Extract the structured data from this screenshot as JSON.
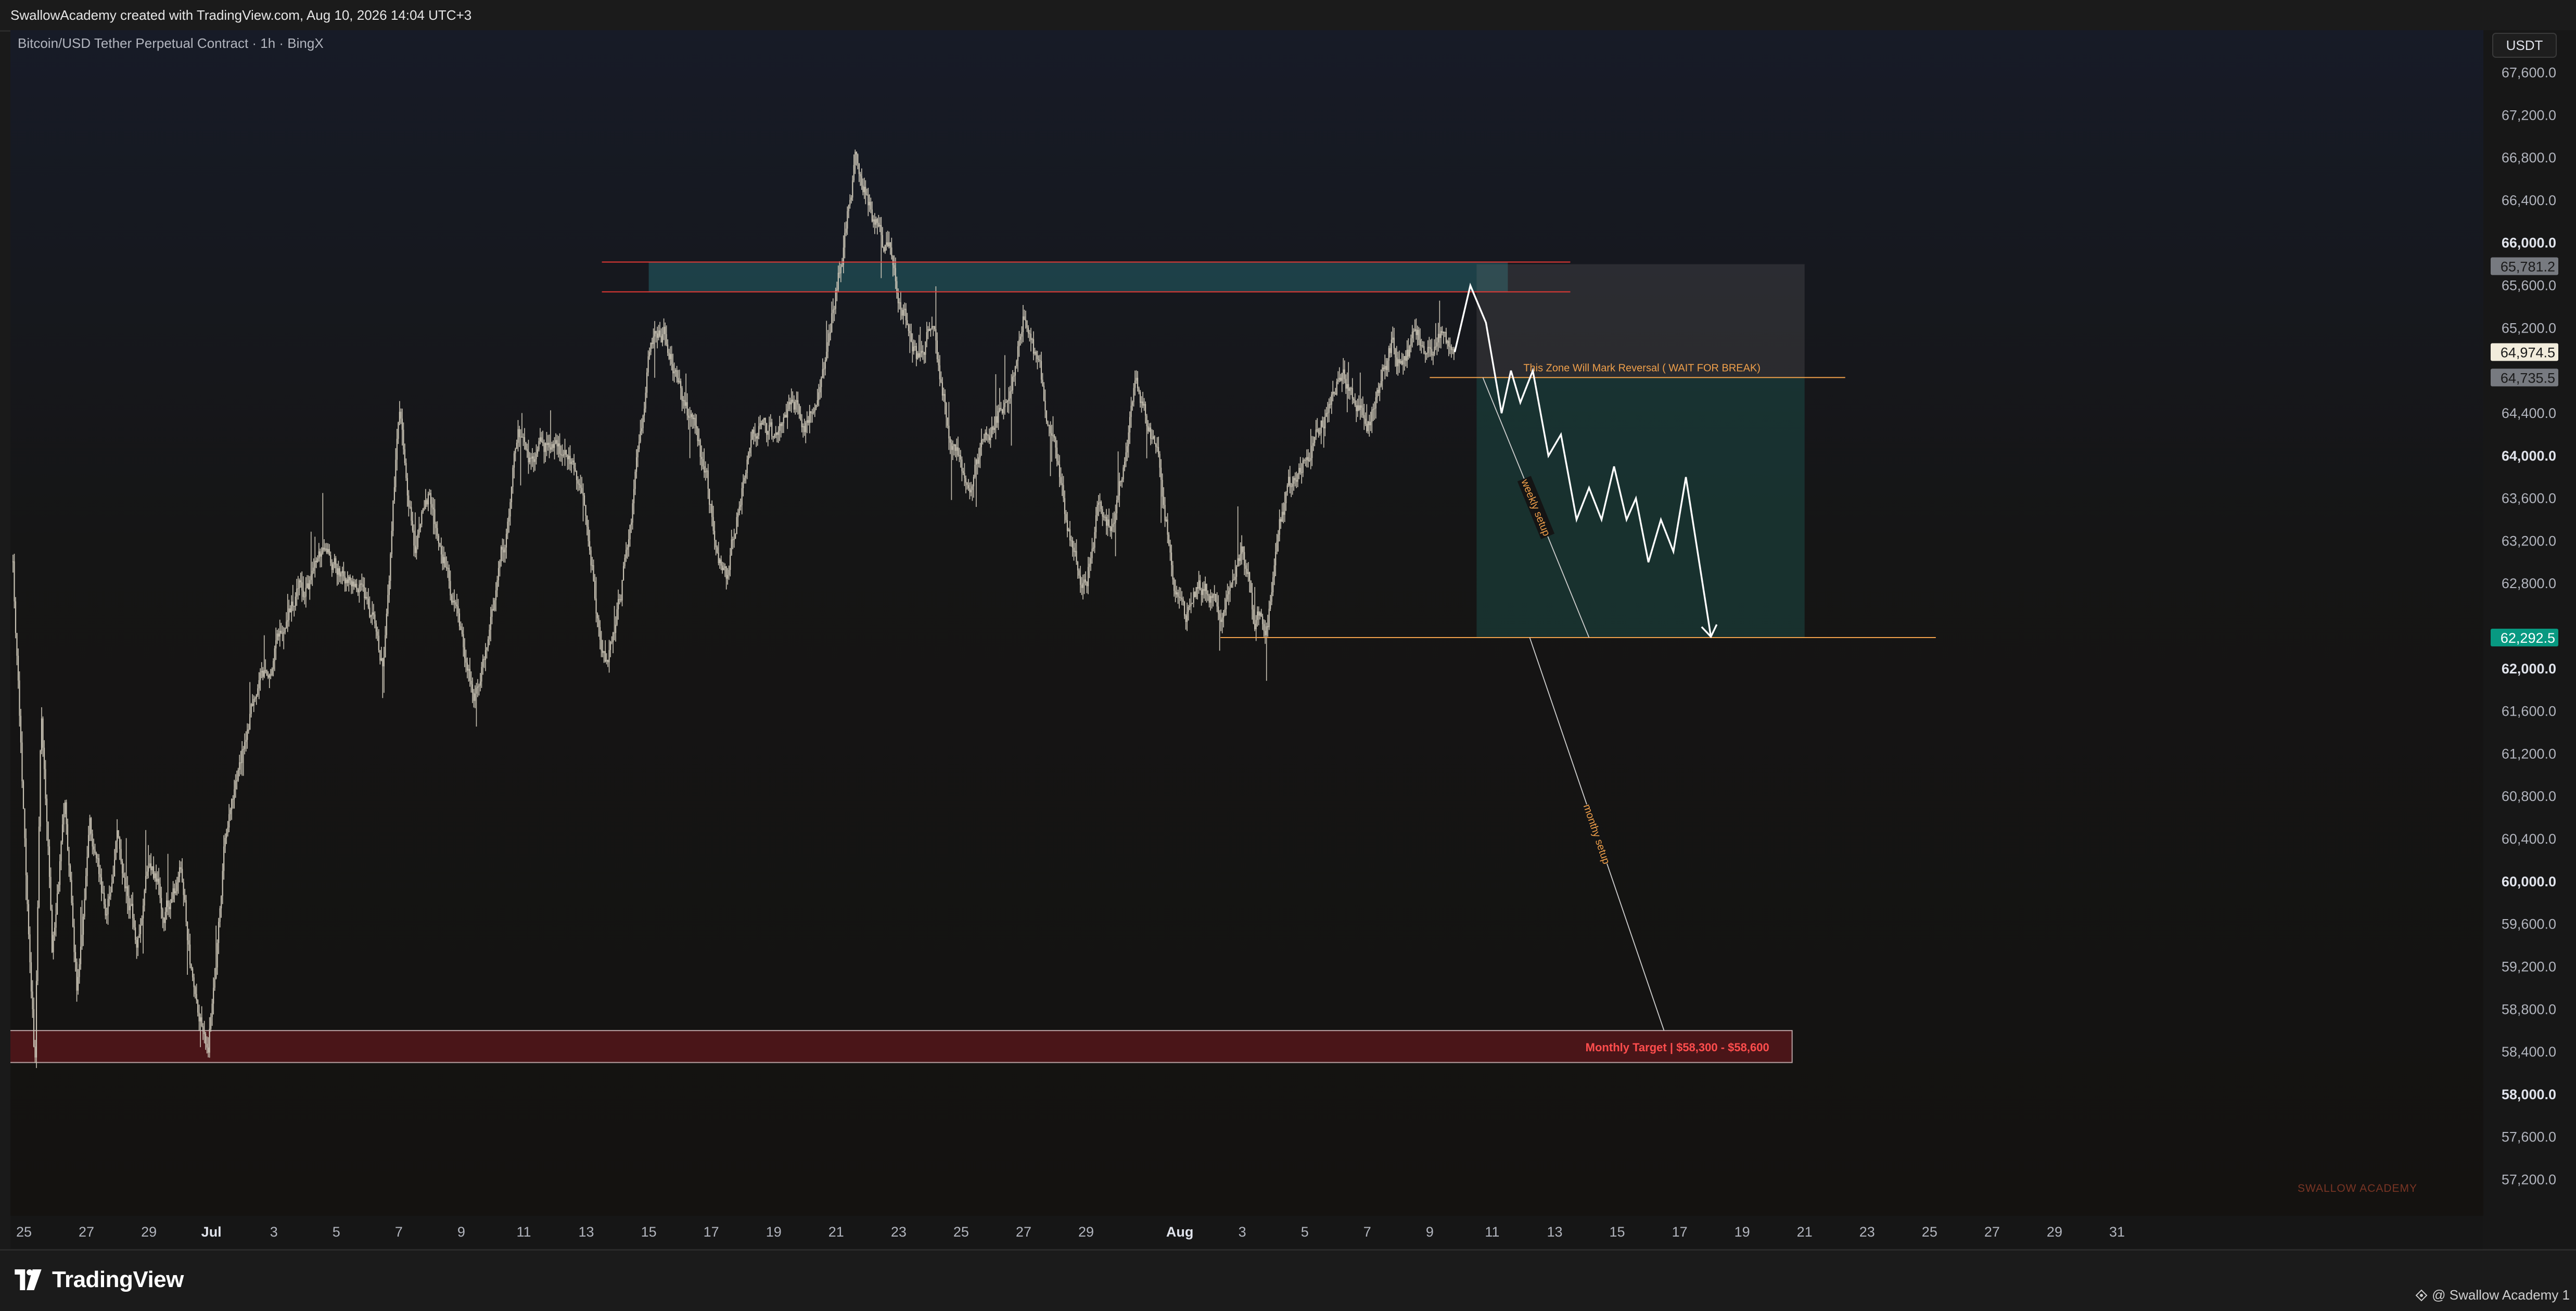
{
  "header": {
    "credit_text": "SwallowAcademy created with TradingView.com, Aug 10, 2026 14:04 UTC+3"
  },
  "chart_header": {
    "symbol_title": "Bitcoin/USD Tether Perpetual Contract · 1h · BingX",
    "currency_button": "USDT"
  },
  "footer": {
    "brand_name": "TradingView",
    "publisher": "@ Swallow Academy 1"
  },
  "colors": {
    "candles": "#c9c3b4",
    "zone_red": "#e53935",
    "zone_teal": "#26707a",
    "orange": "#f0a04b",
    "target_red": "#e53935",
    "badge_green": "#089981",
    "projection": "#ffffff"
  },
  "chart_data": {
    "type": "candlestick",
    "title": "Bitcoin/USD Tether Perpetual Contract · 1h · BingX",
    "y_axis": {
      "currency": "USDT",
      "range": [
        57000,
        67800
      ],
      "ticks": [
        {
          "label": "67,600.0",
          "value": 67600,
          "bold": false
        },
        {
          "label": "67,200.0",
          "value": 67200,
          "bold": false
        },
        {
          "label": "66,800.0",
          "value": 66800,
          "bold": false
        },
        {
          "label": "66,400.0",
          "value": 66400,
          "bold": false
        },
        {
          "label": "66,000.0",
          "value": 66000,
          "bold": true
        },
        {
          "label": "65,600.0",
          "value": 65600,
          "bold": false
        },
        {
          "label": "65,200.0",
          "value": 65200,
          "bold": false
        },
        {
          "label": "64,400.0",
          "value": 64400,
          "bold": false
        },
        {
          "label": "64,000.0",
          "value": 64000,
          "bold": true
        },
        {
          "label": "63,600.0",
          "value": 63600,
          "bold": false
        },
        {
          "label": "63,200.0",
          "value": 63200,
          "bold": false
        },
        {
          "label": "62,800.0",
          "value": 62800,
          "bold": false
        },
        {
          "label": "62,000.0",
          "value": 62000,
          "bold": true
        },
        {
          "label": "61,600.0",
          "value": 61600,
          "bold": false
        },
        {
          "label": "61,200.0",
          "value": 61200,
          "bold": false
        },
        {
          "label": "60,800.0",
          "value": 60800,
          "bold": false
        },
        {
          "label": "60,400.0",
          "value": 60400,
          "bold": false
        },
        {
          "label": "60,000.0",
          "value": 60000,
          "bold": true
        },
        {
          "label": "59,600.0",
          "value": 59600,
          "bold": false
        },
        {
          "label": "59,200.0",
          "value": 59200,
          "bold": false
        },
        {
          "label": "58,800.0",
          "value": 58800,
          "bold": false
        },
        {
          "label": "58,400.0",
          "value": 58400,
          "bold": false
        },
        {
          "label": "58,000.0",
          "value": 58000,
          "bold": true
        },
        {
          "label": "57,600.0",
          "value": 57600,
          "bold": false
        },
        {
          "label": "57,200.0",
          "value": 57200,
          "bold": false
        }
      ],
      "badges": [
        {
          "label": "65,781.2",
          "value": 65781.2,
          "style": "gray"
        },
        {
          "label": "64,974.5",
          "value": 64974.5,
          "style": "light"
        },
        {
          "label": "64,735.5",
          "value": 64735.5,
          "style": "gray"
        },
        {
          "label": "62,292.5",
          "value": 62292.5,
          "style": "green"
        }
      ]
    },
    "x_axis": {
      "range": [
        0,
        67
      ],
      "ticks": [
        {
          "label": "25",
          "day": 0,
          "bold": false
        },
        {
          "label": "27",
          "day": 2,
          "bold": false
        },
        {
          "label": "29",
          "day": 4,
          "bold": false
        },
        {
          "label": "Jul",
          "day": 6,
          "bold": true
        },
        {
          "label": "3",
          "day": 8,
          "bold": false
        },
        {
          "label": "5",
          "day": 10,
          "bold": false
        },
        {
          "label": "7",
          "day": 12,
          "bold": false
        },
        {
          "label": "9",
          "day": 14,
          "bold": false
        },
        {
          "label": "11",
          "day": 16,
          "bold": false
        },
        {
          "label": "13",
          "day": 18,
          "bold": false
        },
        {
          "label": "15",
          "day": 20,
          "bold": false
        },
        {
          "label": "17",
          "day": 22,
          "bold": false
        },
        {
          "label": "19",
          "day": 24,
          "bold": false
        },
        {
          "label": "21",
          "day": 26,
          "bold": false
        },
        {
          "label": "23",
          "day": 28,
          "bold": false
        },
        {
          "label": "25",
          "day": 30,
          "bold": false
        },
        {
          "label": "27",
          "day": 32,
          "bold": false
        },
        {
          "label": "29",
          "day": 34,
          "bold": false
        },
        {
          "label": "Aug",
          "day": 37,
          "bold": true
        },
        {
          "label": "3",
          "day": 39,
          "bold": false
        },
        {
          "label": "5",
          "day": 41,
          "bold": false
        },
        {
          "label": "7",
          "day": 43,
          "bold": false
        },
        {
          "label": "9",
          "day": 45,
          "bold": false
        },
        {
          "label": "11",
          "day": 47,
          "bold": false
        },
        {
          "label": "13",
          "day": 49,
          "bold": false
        },
        {
          "label": "15",
          "day": 51,
          "bold": false
        },
        {
          "label": "17",
          "day": 53,
          "bold": false
        },
        {
          "label": "19",
          "day": 55,
          "bold": false
        },
        {
          "label": "21",
          "day": 57,
          "bold": false
        },
        {
          "label": "23",
          "day": 59,
          "bold": false
        },
        {
          "label": "25",
          "day": 61,
          "bold": false
        },
        {
          "label": "27",
          "day": 63,
          "bold": false
        },
        {
          "label": "29",
          "day": 65,
          "bold": false
        },
        {
          "label": "31",
          "day": 67,
          "bold": false
        }
      ]
    },
    "price_path": [
      [
        -0.35,
        63000
      ],
      [
        0.0,
        60500
      ],
      [
        0.35,
        58300
      ],
      [
        0.55,
        61800
      ],
      [
        0.9,
        59300
      ],
      [
        1.3,
        60800
      ],
      [
        1.7,
        59000
      ],
      [
        2.1,
        60700
      ],
      [
        2.6,
        59700
      ],
      [
        3.0,
        60500
      ],
      [
        3.6,
        59500
      ],
      [
        4.0,
        60300
      ],
      [
        4.5,
        59700
      ],
      [
        5.0,
        60100
      ],
      [
        5.5,
        58700
      ],
      [
        5.9,
        58500
      ],
      [
        6.4,
        60300
      ],
      [
        7.0,
        61200
      ],
      [
        7.5,
        61900
      ],
      [
        8.0,
        62200
      ],
      [
        8.6,
        62600
      ],
      [
        9.1,
        62800
      ],
      [
        9.6,
        63200
      ],
      [
        10.1,
        63000
      ],
      [
        10.6,
        62800
      ],
      [
        11.1,
        62600
      ],
      [
        11.5,
        62000
      ],
      [
        12.0,
        64400
      ],
      [
        12.5,
        63200
      ],
      [
        13.0,
        63600
      ],
      [
        13.5,
        63000
      ],
      [
        14.0,
        62200
      ],
      [
        14.5,
        61800
      ],
      [
        15.0,
        62600
      ],
      [
        15.4,
        63200
      ],
      [
        15.8,
        64200
      ],
      [
        16.3,
        63800
      ],
      [
        16.8,
        64100
      ],
      [
        17.3,
        64000
      ],
      [
        17.8,
        63800
      ],
      [
        18.3,
        62700
      ],
      [
        18.7,
        62100
      ],
      [
        19.1,
        62700
      ],
      [
        19.6,
        63800
      ],
      [
        20.0,
        64900
      ],
      [
        20.5,
        65100
      ],
      [
        21.0,
        64600
      ],
      [
        21.5,
        64200
      ],
      [
        22.0,
        63500
      ],
      [
        22.5,
        62800
      ],
      [
        23.0,
        63800
      ],
      [
        23.5,
        64300
      ],
      [
        24.0,
        64100
      ],
      [
        24.5,
        64600
      ],
      [
        25.0,
        64300
      ],
      [
        25.4,
        64600
      ],
      [
        25.8,
        65300
      ],
      [
        26.2,
        66000
      ],
      [
        26.6,
        66800
      ],
      [
        27.0,
        66400
      ],
      [
        27.4,
        66100
      ],
      [
        27.8,
        65800
      ],
      [
        28.1,
        65500
      ],
      [
        28.6,
        64900
      ],
      [
        29.0,
        65300
      ],
      [
        29.4,
        64600
      ],
      [
        29.8,
        64000
      ],
      [
        30.2,
        63700
      ],
      [
        30.7,
        64100
      ],
      [
        31.2,
        64400
      ],
      [
        31.6,
        64600
      ],
      [
        32.0,
        65300
      ],
      [
        32.4,
        64900
      ],
      [
        32.8,
        64300
      ],
      [
        33.2,
        63700
      ],
      [
        33.6,
        63100
      ],
      [
        34.0,
        62800
      ],
      [
        34.4,
        63600
      ],
      [
        34.8,
        63300
      ],
      [
        35.2,
        63900
      ],
      [
        35.6,
        64700
      ],
      [
        36.0,
        64400
      ],
      [
        36.4,
        63800
      ],
      [
        36.8,
        63000
      ],
      [
        37.2,
        62500
      ],
      [
        37.6,
        62800
      ],
      [
        38.0,
        62700
      ],
      [
        38.3,
        62400
      ],
      [
        38.6,
        62900
      ],
      [
        39.0,
        63200
      ],
      [
        39.4,
        62500
      ],
      [
        39.8,
        62400
      ],
      [
        40.2,
        63500
      ],
      [
        40.6,
        63700
      ],
      [
        41.0,
        64000
      ],
      [
        41.4,
        64300
      ],
      [
        41.8,
        64500
      ],
      [
        42.2,
        64900
      ],
      [
        42.6,
        64500
      ],
      [
        43.0,
        64200
      ],
      [
        43.4,
        64700
      ],
      [
        43.8,
        65100
      ],
      [
        44.2,
        64900
      ],
      [
        44.6,
        65100
      ],
      [
        45.0,
        64900
      ],
      [
        45.4,
        65200
      ],
      [
        45.8,
        64974.5
      ]
    ],
    "series": [
      {
        "name": "",
        "type": "projection",
        "points": [
          [
            45.8,
            64974.5
          ],
          [
            46.3,
            65600
          ],
          [
            46.8,
            65250
          ],
          [
            47.3,
            64400
          ],
          [
            47.6,
            64800
          ],
          [
            47.9,
            64500
          ],
          [
            48.3,
            64800
          ],
          [
            48.8,
            64000
          ],
          [
            49.2,
            64200
          ],
          [
            49.7,
            63400
          ],
          [
            50.1,
            63700
          ],
          [
            50.5,
            63400
          ],
          [
            50.9,
            63900
          ],
          [
            51.3,
            63400
          ],
          [
            51.6,
            63600
          ],
          [
            52.0,
            63000
          ],
          [
            52.4,
            63400
          ],
          [
            52.8,
            63100
          ],
          [
            53.2,
            63800
          ],
          [
            54.0,
            62300
          ]
        ]
      }
    ],
    "annotations": [
      {
        "type": "hline",
        "value": 65820,
        "x_range": [
          18.5,
          49.5
        ],
        "color": "red"
      },
      {
        "type": "hline",
        "value": 65540,
        "x_range": [
          18.5,
          49.5
        ],
        "color": "red"
      },
      {
        "type": "rect",
        "y_range": [
          65540,
          65820
        ],
        "x_range": [
          20.0,
          47.5
        ],
        "color": "teal",
        "label": ""
      },
      {
        "type": "rect",
        "y_range": [
          64735.5,
          65800
        ],
        "x_range": [
          46.5,
          57.0
        ],
        "color": "gray",
        "label": ""
      },
      {
        "type": "rect",
        "y_range": [
          62292.5,
          64735.5
        ],
        "x_range": [
          46.5,
          57.0
        ],
        "color": "teal",
        "label": ""
      },
      {
        "type": "hline",
        "value": 64735.5,
        "x_range": [
          45.0,
          58.3
        ],
        "color": "orange",
        "label": "This Zone Will Mark Reversal ( WAIT FOR BREAK)"
      },
      {
        "type": "hline",
        "value": 62292.5,
        "x_range": [
          38.3,
          61.2
        ],
        "color": "orange"
      },
      {
        "type": "line",
        "from": [
          46.7,
          64735.5
        ],
        "to": [
          50.1,
          62292.5
        ],
        "label": "weekly setup"
      },
      {
        "type": "line",
        "from": [
          48.2,
          62292.5
        ],
        "to": [
          52.5,
          58600
        ],
        "label": "monthy setup"
      },
      {
        "type": "rect",
        "y_range": [
          58300,
          58600
        ],
        "x_range": [
          -0.6,
          56.6
        ],
        "color": "red",
        "label": "Monthly Target | $58,300 - $58,600"
      }
    ],
    "watermark": "SWALLOW ACADEMY"
  }
}
